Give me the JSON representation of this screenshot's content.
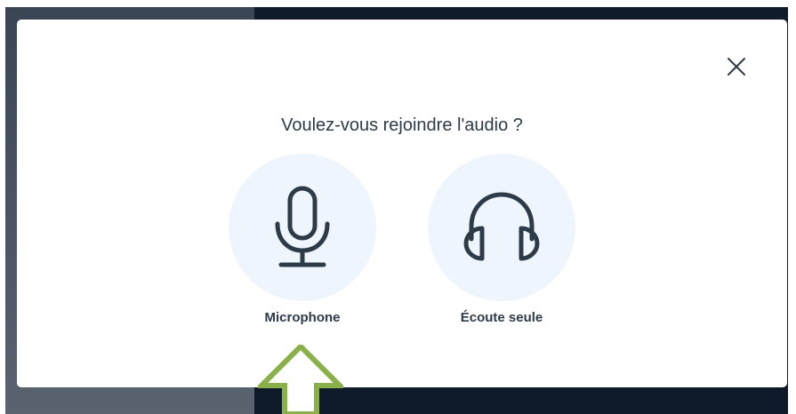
{
  "dialog": {
    "title": "Voulez-vous rejoindre l'audio ?",
    "close_icon": "close-icon",
    "options": [
      {
        "label": "Microphone",
        "icon": "microphone-icon"
      },
      {
        "label": "Écoute seule",
        "icon": "headphones-icon"
      }
    ]
  },
  "annotation": {
    "icon": "up-arrow-icon",
    "color": "#8ab04a"
  },
  "colors": {
    "icon_stroke": "#2d3a48",
    "option_circle": "#eef5fc",
    "backdrop": "#0f1b2b"
  }
}
